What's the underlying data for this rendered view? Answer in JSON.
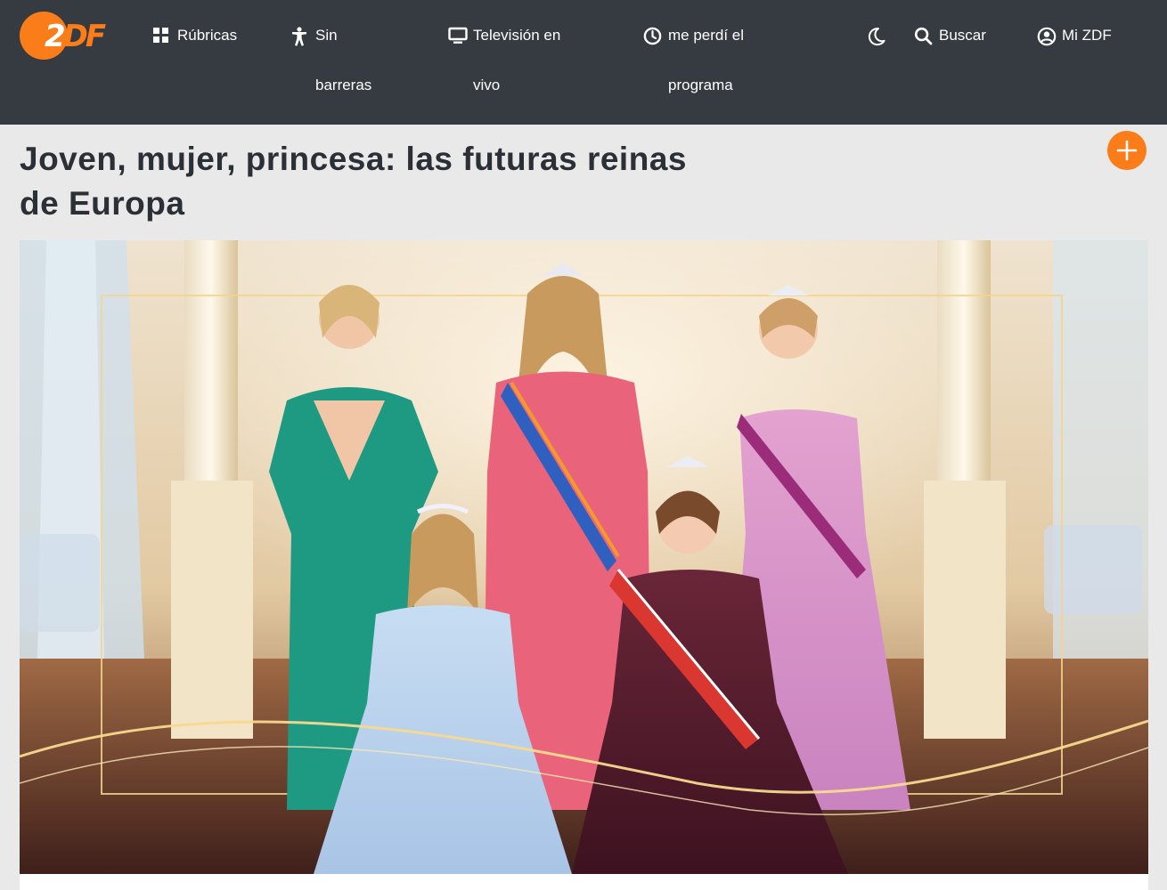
{
  "header": {
    "logo_text": "ZDF",
    "nav": [
      {
        "label_line1": "Rúbricas",
        "label_line2": "",
        "icon": "grid-icon"
      },
      {
        "label_line1": "Sin",
        "label_line2": "barreras",
        "icon": "accessibility-icon"
      },
      {
        "label_line1": "Televisión en",
        "label_line2": "vivo",
        "icon": "tv-icon"
      },
      {
        "label_line1": "me perdí el",
        "label_line2": "programa",
        "icon": "clock-icon"
      },
      {
        "label_line1": "",
        "label_line2": "",
        "icon": "moon-icon"
      },
      {
        "label_line1": "Buscar",
        "label_line2": "",
        "icon": "search-icon"
      },
      {
        "label_line1": "Mi ZDF",
        "label_line2": "",
        "icon": "user-circle-icon"
      }
    ]
  },
  "page": {
    "title": "Joven, mujer, princesa: las futuras reinas de Europa",
    "add_icon": "plus-icon"
  },
  "colors": {
    "header_bg": "#363a41",
    "accent": "#fa7d19",
    "page_bg": "#e9e9e9",
    "title_text": "#2b2f36"
  }
}
